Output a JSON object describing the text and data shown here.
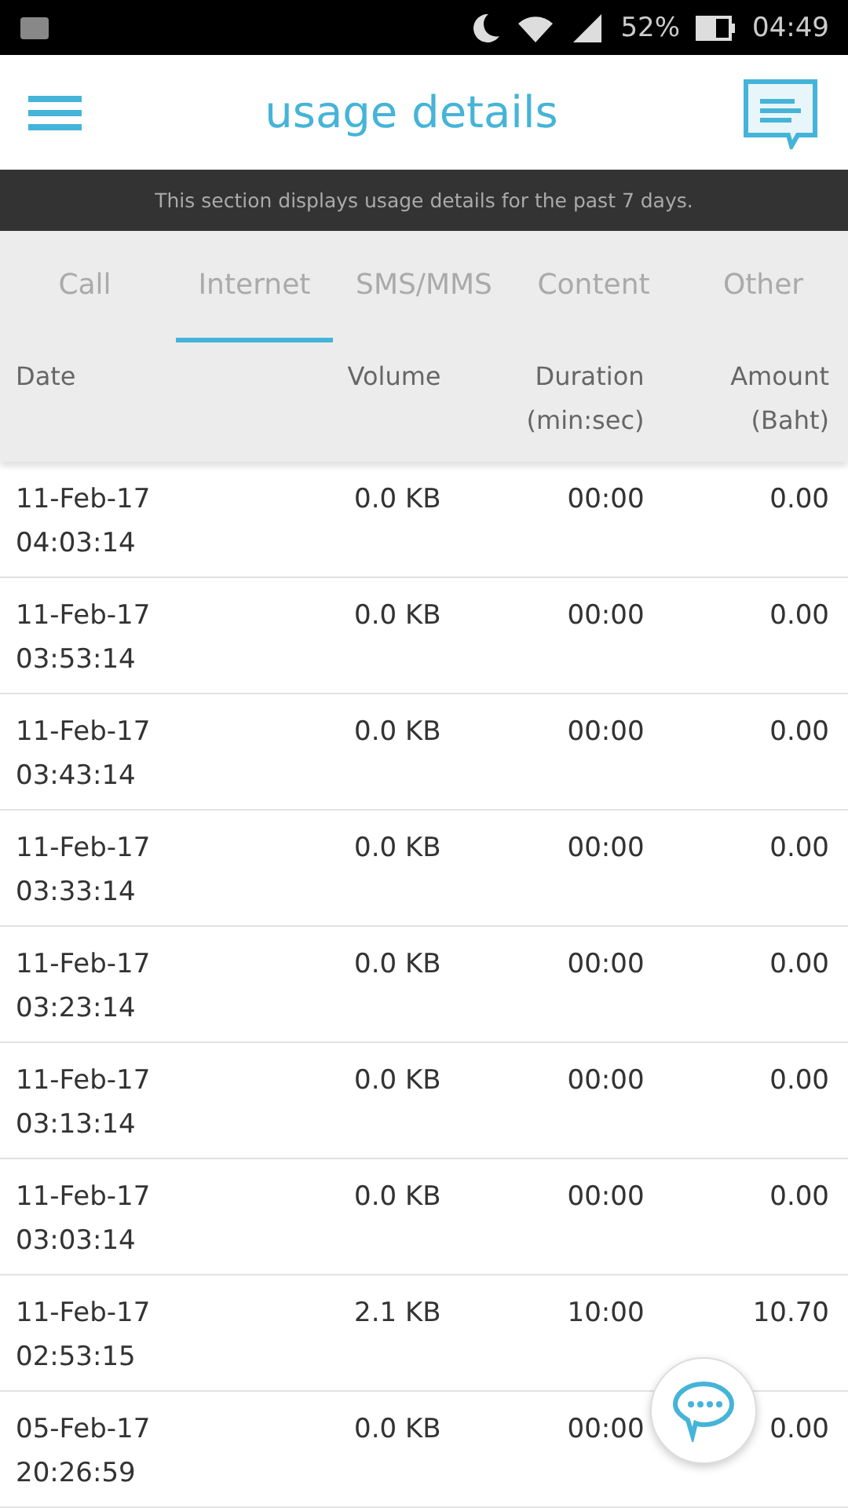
{
  "status_bar": {
    "battery": "52%",
    "time": "04:49"
  },
  "header": {
    "title": "usage details"
  },
  "notice": "This section displays usage details for the past 7 days.",
  "tabs": [
    {
      "label": "Call",
      "selected": false
    },
    {
      "label": "Internet",
      "selected": true
    },
    {
      "label": "SMS/MMS",
      "selected": false
    },
    {
      "label": "Content",
      "selected": false
    },
    {
      "label": "Other",
      "selected": false
    }
  ],
  "table": {
    "columns": [
      {
        "label": "Date"
      },
      {
        "label": "Volume"
      },
      {
        "label": "Duration",
        "sub": "(min:sec)"
      },
      {
        "label": "Amount",
        "sub": "(Baht)"
      }
    ],
    "rows": [
      {
        "date": "11-Feb-17",
        "time": "04:03:14",
        "volume": "0.0 KB",
        "duration": "00:00",
        "amount": "0.00"
      },
      {
        "date": "11-Feb-17",
        "time": "03:53:14",
        "volume": "0.0 KB",
        "duration": "00:00",
        "amount": "0.00"
      },
      {
        "date": "11-Feb-17",
        "time": "03:43:14",
        "volume": "0.0 KB",
        "duration": "00:00",
        "amount": "0.00"
      },
      {
        "date": "11-Feb-17",
        "time": "03:33:14",
        "volume": "0.0 KB",
        "duration": "00:00",
        "amount": "0.00"
      },
      {
        "date": "11-Feb-17",
        "time": "03:23:14",
        "volume": "0.0 KB",
        "duration": "00:00",
        "amount": "0.00"
      },
      {
        "date": "11-Feb-17",
        "time": "03:13:14",
        "volume": "0.0 KB",
        "duration": "00:00",
        "amount": "0.00"
      },
      {
        "date": "11-Feb-17",
        "time": "03:03:14",
        "volume": "0.0 KB",
        "duration": "00:00",
        "amount": "0.00"
      },
      {
        "date": "11-Feb-17",
        "time": "02:53:15",
        "volume": "2.1 KB",
        "duration": "10:00",
        "amount": "10.70"
      },
      {
        "date": "05-Feb-17",
        "time": "20:26:59",
        "volume": "0.0 KB",
        "duration": "00:00",
        "amount": "0.00"
      }
    ]
  }
}
